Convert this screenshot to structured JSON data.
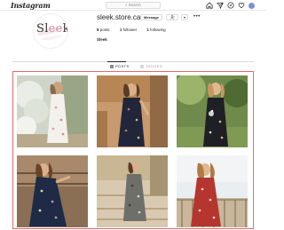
{
  "nav": {
    "logo": "Instagram",
    "search_placeholder": "Search",
    "icons": [
      "home-icon",
      "paper-plane-icon",
      "compass-icon",
      "heart-icon",
      "avatar"
    ]
  },
  "profile": {
    "avatar_logo": {
      "prefix": "Sl",
      "accent": "ee",
      "suffix": "k"
    },
    "username": "sleek.store.ca",
    "message_label": "Message",
    "follow_icon": "person-check-icon",
    "dropdown_icon": "chevron-down-icon",
    "more_label": "•••",
    "stats": [
      {
        "count": "8",
        "label": "posts"
      },
      {
        "count": "1",
        "label": "follower"
      },
      {
        "count": "1",
        "label": "following"
      }
    ],
    "full_name": "Sleek"
  },
  "tabs": [
    {
      "label": "POSTS",
      "icon": "grid-icon",
      "active": true
    },
    {
      "label": "TAGGED",
      "icon": "tag-icon",
      "active": false
    }
  ],
  "posts": [
    {
      "description": "Model in white floral dress beside blossoming tree"
    },
    {
      "description": "Model in dark floral wrap dress against stone wall"
    },
    {
      "description": "Model in black floral dress in green garden"
    },
    {
      "description": "Model in navy floral dress by wooden fence"
    },
    {
      "description": "Model in patterned dress on stone steps"
    },
    {
      "description": "Model in red floral dress by railing"
    }
  ],
  "colors": {
    "highlight": "#e46a6a",
    "accent_avatar": "#d48aa0",
    "text": "#262626",
    "muted": "#8e8e8e"
  }
}
